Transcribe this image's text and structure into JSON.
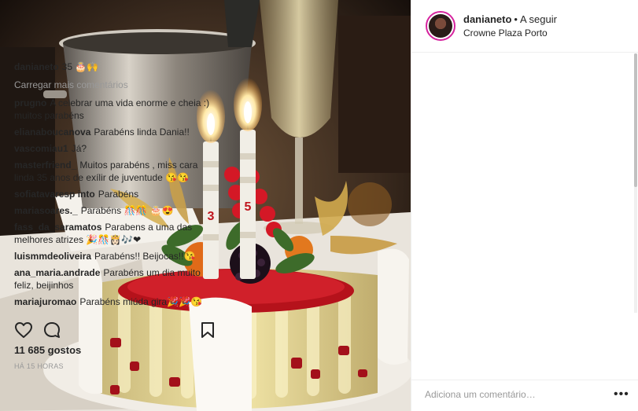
{
  "post": {
    "header": {
      "username": "danianeto",
      "separator": "•",
      "follow_label": "A seguir",
      "location": "Crowne Plaza Porto"
    },
    "caption": {
      "username": "danianeto",
      "text": "35 🎂🙌"
    },
    "load_more_label": "Carregar mais comentários",
    "comments": [
      {
        "username": "prugno",
        "text": "A celebrar uma vida enorme e cheia :) muitos parabéns"
      },
      {
        "username": "elianaboucanova",
        "text": "Parabéns linda Dania!!"
      },
      {
        "username": "vascomiau1",
        "text": "Já?"
      },
      {
        "username": "masterfriend_",
        "text": "Muitos parabéns , miss cara linda 35 anos de exílir de juventude 😘😘"
      },
      {
        "username": "sofiatavaresp into",
        "text": "Parabéns"
      },
      {
        "username": "mariasoares._",
        "text": "Parabéns 🎊🎊 🎂😍"
      },
      {
        "username": "fass_da_saramatos",
        "text": "Parabens a uma das melhores atrizes 🎉🎊👸🏻🎶❤"
      },
      {
        "username": "luismmdeoliveira",
        "text": "Parabéns!! Beijocas!!😘"
      },
      {
        "username": "ana_maria.andrade",
        "text": "Parabéns um dia muito feliz, beijinhos"
      },
      {
        "username": "mariajuromao",
        "text": "Parabéns miúda gira🎉🎉😘"
      }
    ],
    "likes_label": "11 685 gostos",
    "time_label": "HÁ 15 HORAS",
    "comment_placeholder": "Adiciona um comentário…",
    "more_label": "•••",
    "icons": {
      "like": "heart-outline-icon",
      "comment": "speech-bubble-icon",
      "save": "bookmark-icon"
    },
    "colors": {
      "avatar_ring": "#d6249f",
      "muted_text": "#999999",
      "divider": "#efefef"
    },
    "photo": {
      "candle_numbers": [
        "3",
        "5"
      ]
    }
  }
}
